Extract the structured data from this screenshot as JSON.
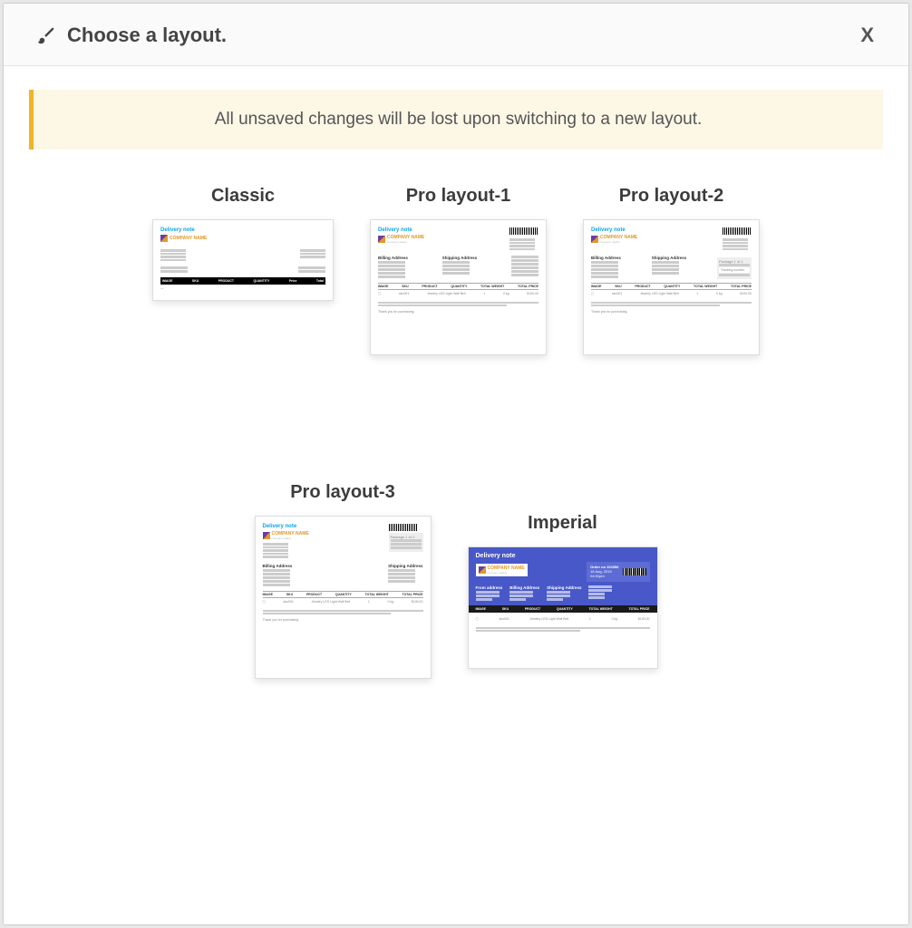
{
  "header": {
    "title": "Choose a layout.",
    "close": "X"
  },
  "banner": "All unsaved changes will be lost upon switching to a new layout.",
  "layouts": {
    "classic": {
      "label": "Classic"
    },
    "pro1": {
      "label": "Pro layout-1"
    },
    "pro2": {
      "label": "Pro layout-2"
    },
    "pro3": {
      "label": "Pro layout-3"
    },
    "imperial": {
      "label": "Imperial"
    }
  },
  "preview_common": {
    "doc_title": "Delivery note",
    "company_name": "COMPANY NAME",
    "company_tagline": "company tagline",
    "billing_address_label": "Billing Address",
    "shipping_address_label": "Shipping Address",
    "package_label": "Package 1 of 1",
    "thank_you": "Thank you for purchasing.",
    "cols": {
      "image": "IMAGE",
      "sku": "SKU",
      "product": "PRODUCT",
      "quantity": "QUANTITY",
      "total_weight": "TOTAL WEIGHT",
      "total_price": "TOTAL PRICE",
      "price": "Price",
      "total": "Total"
    },
    "imperial_order": "Order no 102356"
  }
}
